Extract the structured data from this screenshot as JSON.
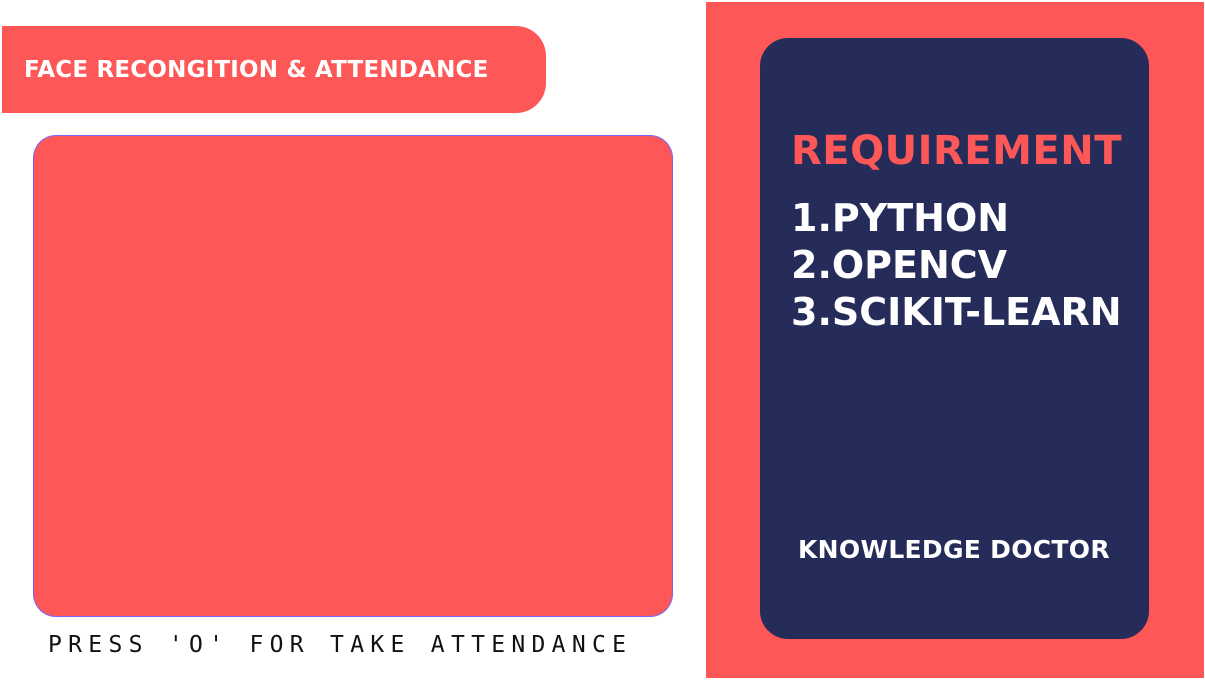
{
  "header": {
    "title": "FACE RECONGITION & ATTENDANCE"
  },
  "camera": {
    "instruction": "PRESS 'O' FOR TAKE ATTENDANCE"
  },
  "requirements": {
    "heading": "REQUIREMENT",
    "items": [
      "1.PYTHON",
      "2.OPENCV",
      "3.SCIKIT-LEARN"
    ],
    "footer": "KNOWLEDGE DOCTOR"
  },
  "colors": {
    "accent_red": "#fe5757",
    "card_navy": "#262c59",
    "background": "#ffffff",
    "text_light": "#ffffff",
    "text_dark": "#111111"
  }
}
